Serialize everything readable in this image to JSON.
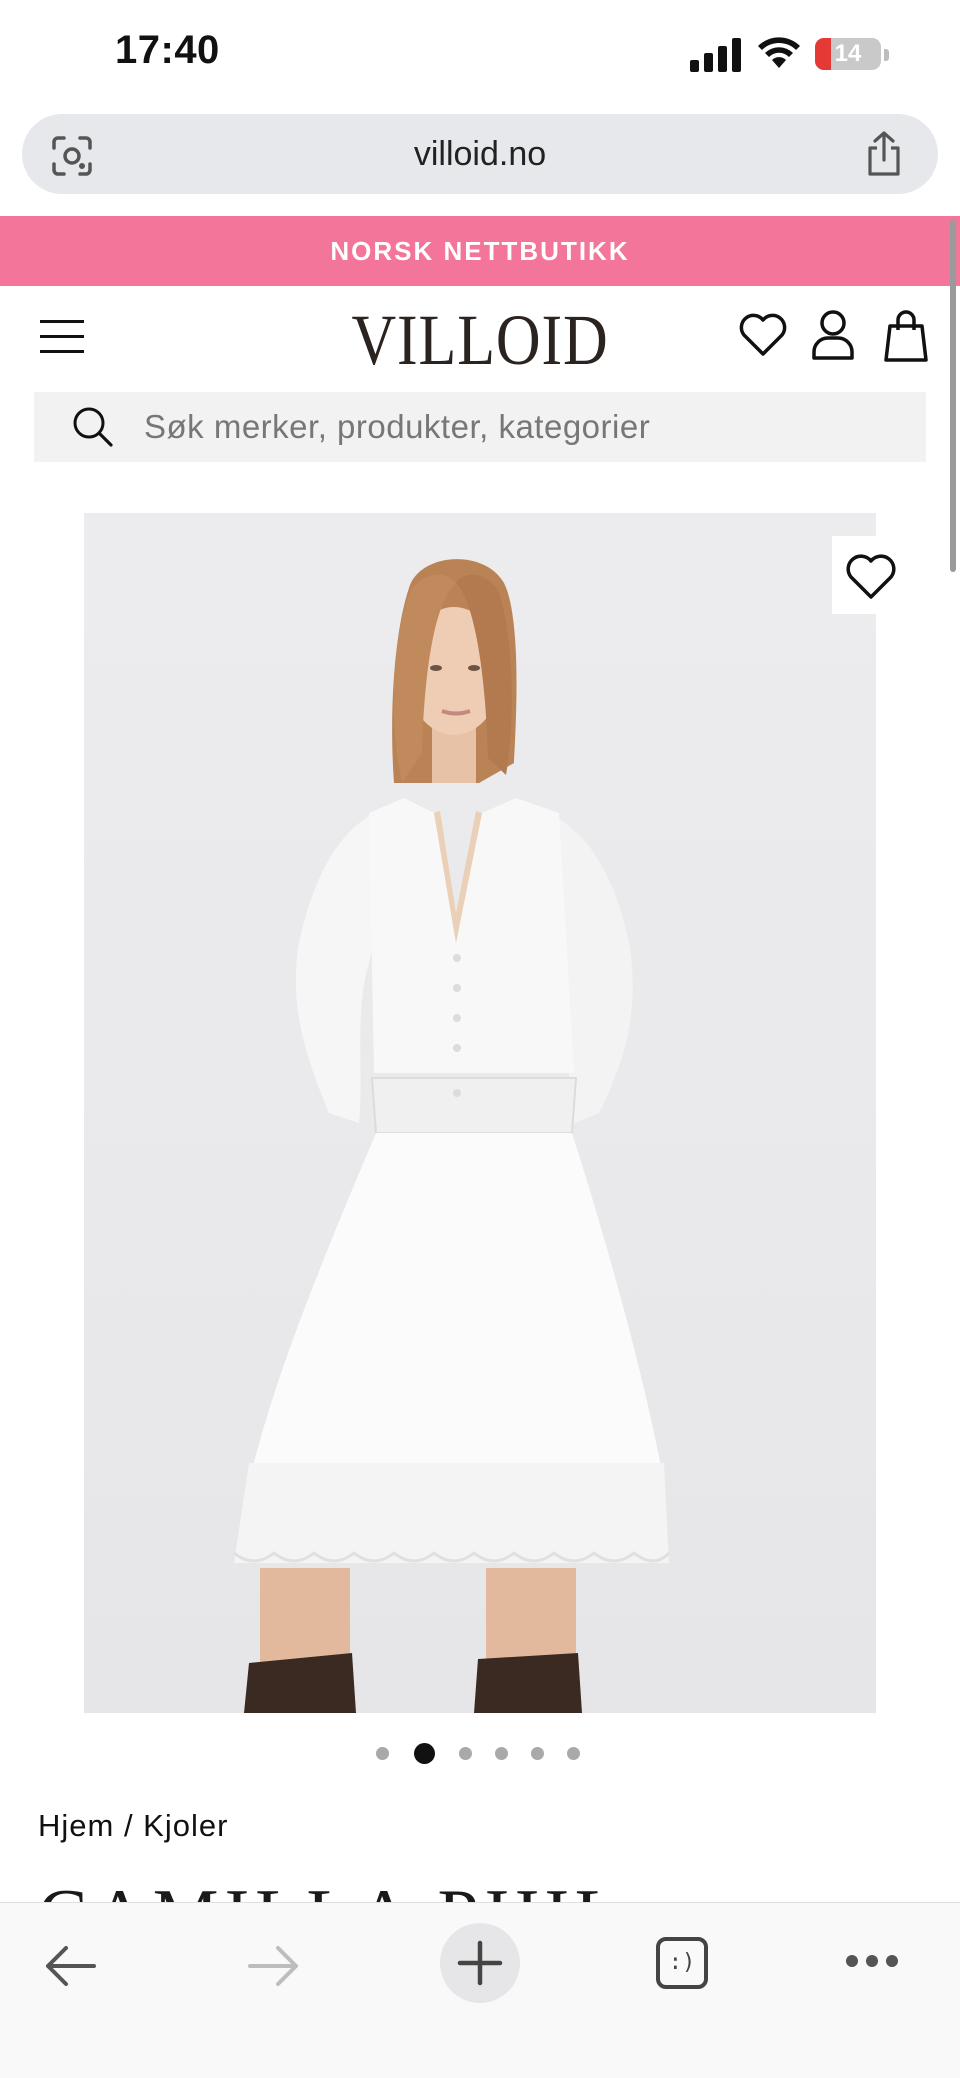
{
  "status_bar": {
    "time": "17:40",
    "battery_level": "14",
    "battery_color": "#e53935",
    "icons": [
      "signal-icon",
      "wifi-icon",
      "battery-icon"
    ]
  },
  "browser": {
    "url": "villoid.no",
    "icons": [
      "lens-icon",
      "share-icon"
    ]
  },
  "promo": {
    "text": "NORSK NETTBUTIKK",
    "background": "#f37599"
  },
  "header": {
    "logo": "VILLOID",
    "icons": [
      "menu-icon",
      "heart-icon",
      "account-icon",
      "shopping-bag-icon"
    ]
  },
  "search": {
    "placeholder": "Søk merker, produkter, kategorier"
  },
  "product": {
    "image_count": 6,
    "active_image": 2,
    "breadcrumb": "Hjem / Kjoler",
    "title_partial": "CAMILLA PIHL"
  },
  "toolbar": {
    "tabs_label": ":)",
    "icons": [
      "back-arrow-icon",
      "forward-arrow-icon",
      "plus-icon",
      "tabs-icon",
      "more-icon"
    ]
  }
}
